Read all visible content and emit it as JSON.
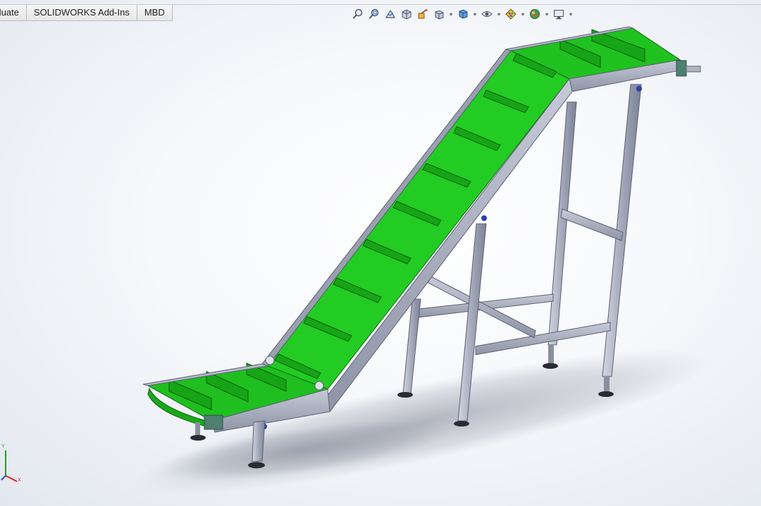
{
  "tabs": {
    "evaluate": "Evaluate",
    "addins": "SOLIDWORKS Add-Ins",
    "mbd": "MBD"
  },
  "heads_up_toolbar": {
    "items": [
      "zoom-to-fit-icon",
      "zoom-to-area-icon",
      "previous-view-icon",
      "section-view-icon",
      "dynamic-annotation-icon",
      "view-orientation-icon",
      "display-style-icon",
      "hide-show-items-icon",
      "edit-appearance-icon",
      "apply-scene-icon",
      "view-settings-icon"
    ]
  },
  "triad": {
    "y_label": "Y",
    "x_label": "X"
  },
  "colors": {
    "belt": "#22cc22",
    "belt_dark": "#14a814",
    "frame": "#a9aec0",
    "frame_dark": "#6f7486",
    "accent_blue": "#2b3fb0"
  }
}
